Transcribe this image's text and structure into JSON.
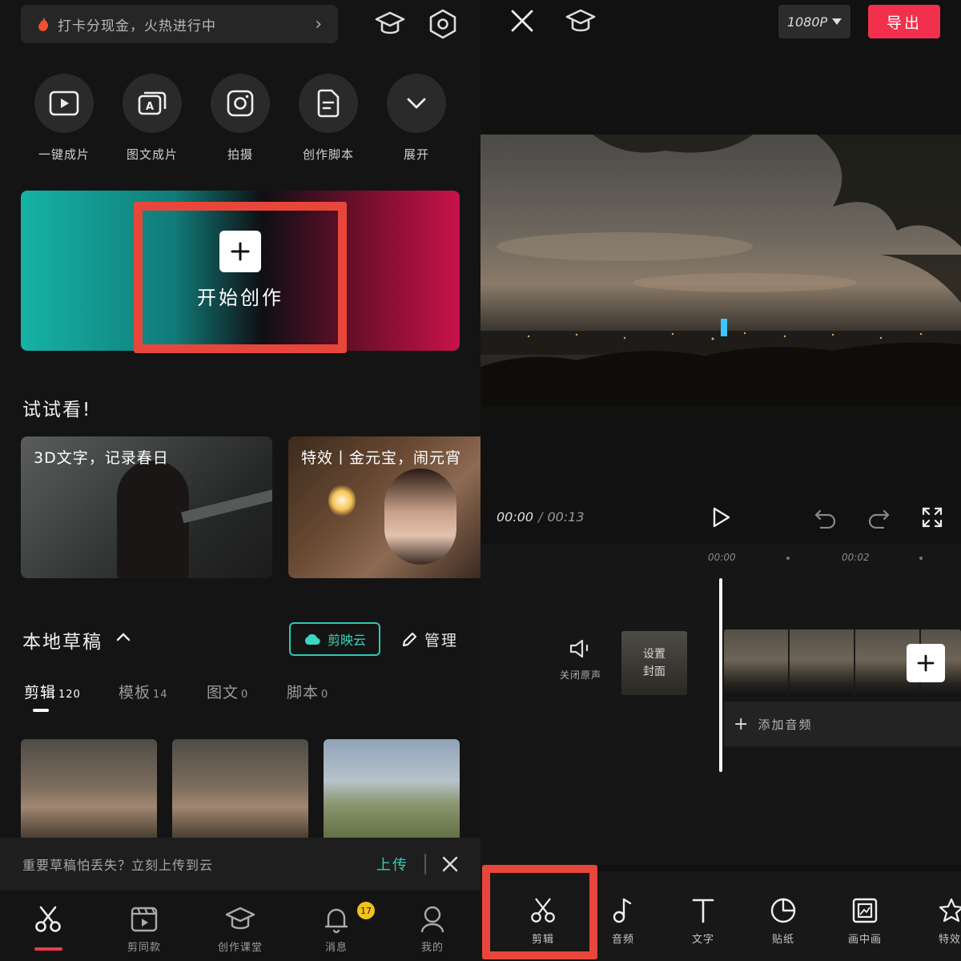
{
  "left": {
    "promo": {
      "text": "打卡分现金，火热进行中",
      "chevron": "›"
    },
    "top_icons": [
      "graduation-cap-icon",
      "settings-hex-icon"
    ],
    "tools": [
      {
        "label": "一键成片",
        "icon": "play-box-icon"
      },
      {
        "label": "图文成片",
        "icon": "text-image-icon"
      },
      {
        "label": "拍摄",
        "icon": "camera-icon"
      },
      {
        "label": "创作脚本",
        "icon": "script-icon"
      },
      {
        "label": "展开",
        "icon": "chevron-down-icon"
      }
    ],
    "start": {
      "label": "开始创作"
    },
    "try_title": "试试看!",
    "cards": [
      {
        "title": "3D文字，记录春日"
      },
      {
        "title": "特效丨金元宝，闹元宵"
      }
    ],
    "drafts": {
      "title": "本地草稿",
      "cloud_label": "剪映云",
      "manage_label": "管理",
      "tabs": [
        {
          "label": "剪辑",
          "count": "120"
        },
        {
          "label": "模板",
          "count": "14"
        },
        {
          "label": "图文",
          "count": "0"
        },
        {
          "label": "脚本",
          "count": "0"
        }
      ]
    },
    "upload": {
      "text": "重要草稿怕丢失？立刻上传到云",
      "button": "上传"
    },
    "nav": [
      {
        "label": "",
        "icon": "scissors-icon"
      },
      {
        "label": "剪同款",
        "icon": "clapper-icon"
      },
      {
        "label": "创作课堂",
        "icon": "graduation-cap-icon"
      },
      {
        "label": "消息",
        "icon": "bell-icon"
      },
      {
        "label": "我的",
        "icon": "user-icon"
      }
    ],
    "badge": "17"
  },
  "right": {
    "resolution": "1080P",
    "export": "导出",
    "time_current": "00:00",
    "time_separator": "/",
    "time_total": "00:13",
    "ticks": [
      "00:00",
      "00:02"
    ],
    "mute_label": "关闭原声",
    "cover_line1": "设置",
    "cover_line2": "封面",
    "add_audio": "添加音频",
    "toolbar": [
      {
        "label": "剪辑",
        "icon": "scissors-icon"
      },
      {
        "label": "音频",
        "icon": "music-note-icon"
      },
      {
        "label": "文字",
        "icon": "text-T-icon"
      },
      {
        "label": "贴纸",
        "icon": "sticker-icon"
      },
      {
        "label": "画中画",
        "icon": "picture-in-picture-icon"
      },
      {
        "label": "特效",
        "icon": "effects-star-icon"
      }
    ]
  },
  "colors": {
    "accent_red": "#f0304d",
    "accent_teal": "#2fc8b4",
    "highlight": "#e8463a"
  }
}
